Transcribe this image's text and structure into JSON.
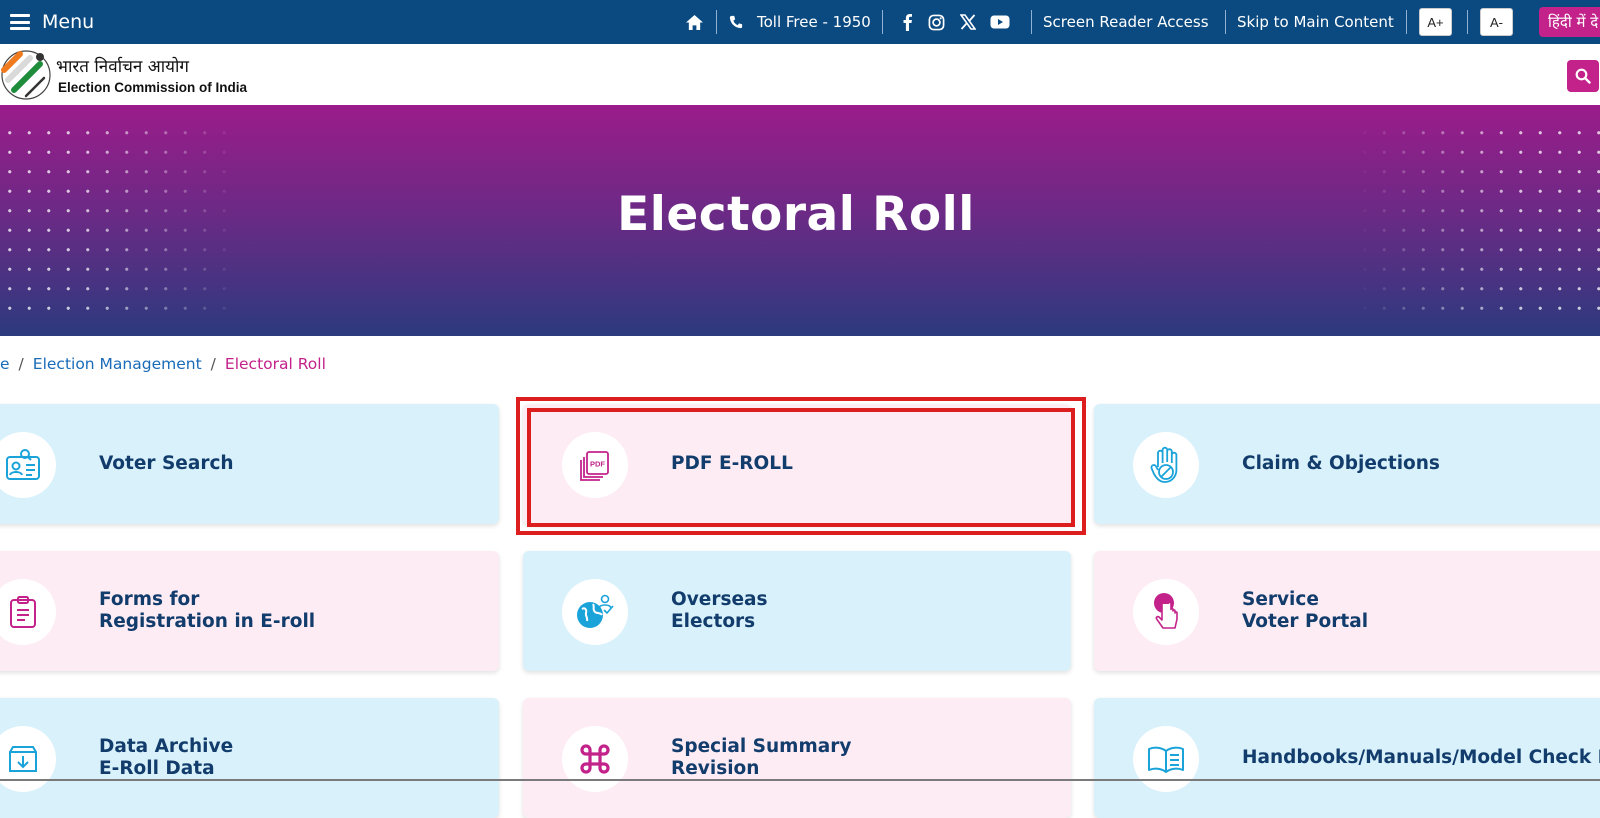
{
  "topbar": {
    "menu_label": "Menu",
    "toll_free": "Toll Free - 1950",
    "screen_reader": "Screen Reader Access",
    "skip_main": "Skip to Main Content",
    "font_increase": "A+",
    "font_decrease": "A-",
    "language": "हिंदी में दे",
    "icons": [
      "home-icon",
      "phone-icon",
      "facebook-icon",
      "instagram-icon",
      "x-icon",
      "youtube-icon"
    ],
    "bg_color": "#0b4a80"
  },
  "header": {
    "org_hindi": "भारत निर्वाचन आयोग",
    "org_english": "Election Commission of India"
  },
  "hero": {
    "title": "Electoral Roll"
  },
  "breadcrumb": {
    "items": [
      "e",
      "Election Management",
      "Electoral Roll"
    ],
    "separator": "/"
  },
  "cards": [
    {
      "title": "Voter Search",
      "line2": "",
      "icon": "voter-id-search-icon",
      "theme": "blue"
    },
    {
      "title": "PDF E-ROLL",
      "line2": "",
      "icon": "pdf-document-icon",
      "theme": "pink",
      "selected": true
    },
    {
      "title": "Claim & Objections",
      "line2": "",
      "icon": "raised-hand-icon",
      "theme": "blue"
    },
    {
      "title": "Forms for",
      "line2": "Registration in E-roll",
      "icon": "clipboard-form-icon",
      "theme": "pink"
    },
    {
      "title": "Overseas",
      "line2": "Electors",
      "icon": "globe-user-icon",
      "theme": "blue"
    },
    {
      "title": "Service",
      "line2": "Voter Portal",
      "icon": "touch-finger-icon",
      "theme": "pink"
    },
    {
      "title": "Data Archive",
      "line2": "E-Roll Data",
      "icon": "download-archive-icon",
      "theme": "blue"
    },
    {
      "title": "Special Summary",
      "line2": "Revision",
      "icon": "command-icon",
      "theme": "pink"
    },
    {
      "title": "Handbooks/Manuals/Model Check List",
      "line2": "",
      "icon": "open-book-icon",
      "theme": "blue"
    }
  ],
  "colors": {
    "accent": "#c2228a",
    "link": "#1a6bb8",
    "card_title": "#123c6c",
    "highlight": "#dd1e1e"
  }
}
